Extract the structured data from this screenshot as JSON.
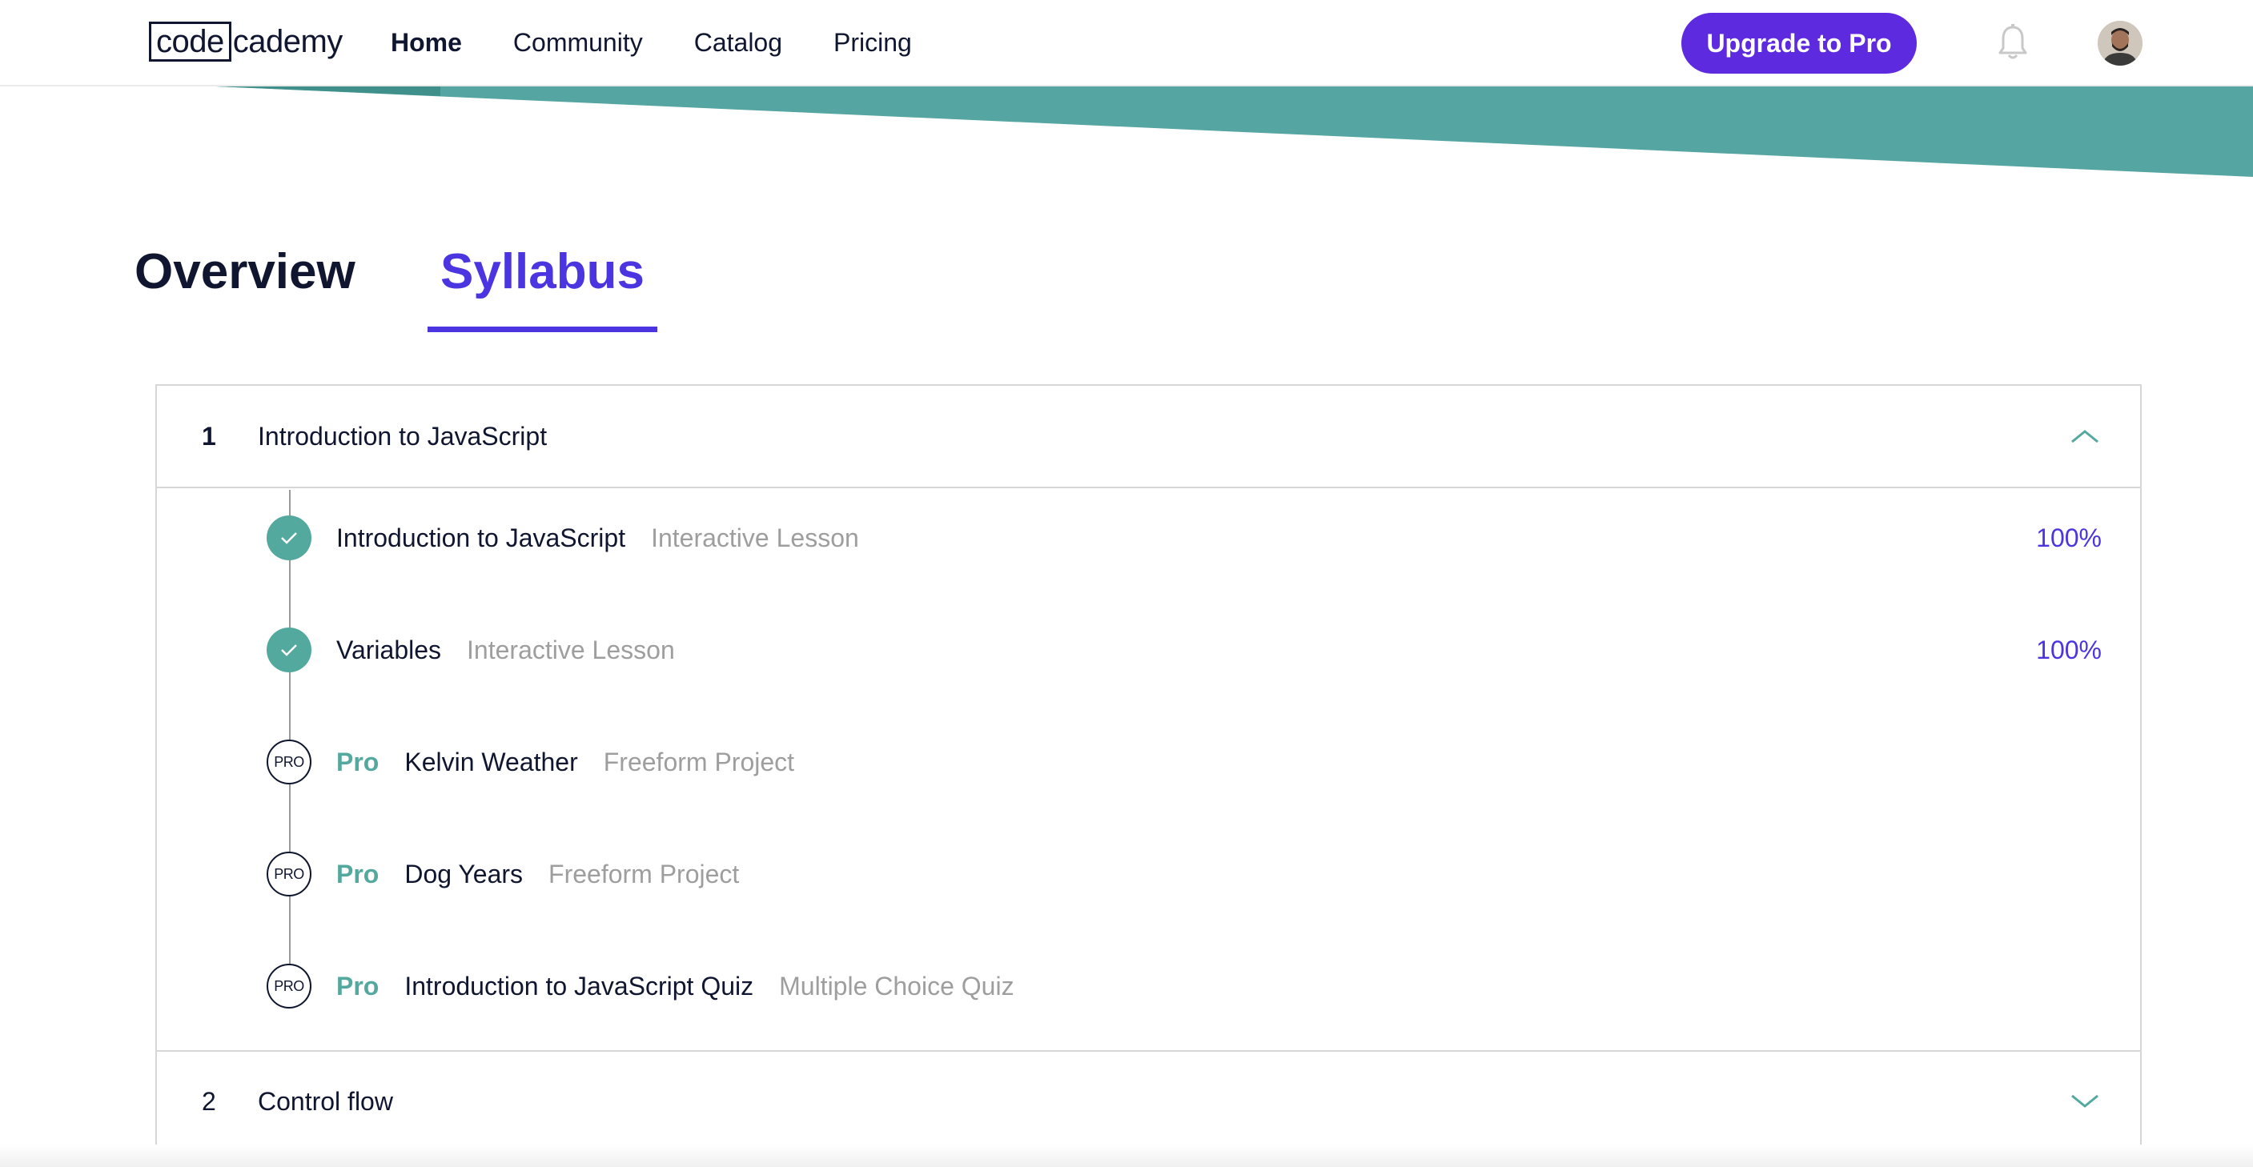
{
  "header": {
    "logo": {
      "boxed": "code",
      "rest": "cademy"
    },
    "nav": [
      {
        "label": "Home",
        "active": true
      },
      {
        "label": "Community",
        "active": false
      },
      {
        "label": "Catalog",
        "active": false
      },
      {
        "label": "Pricing",
        "active": false
      }
    ],
    "upgrade_label": "Upgrade to Pro",
    "icons": {
      "notifications": "bell-icon",
      "profile": "avatar"
    }
  },
  "tabs": [
    {
      "label": "Overview",
      "active": false
    },
    {
      "label": "Syllabus",
      "active": true
    }
  ],
  "modules": [
    {
      "number": "1",
      "title": "Introduction to JavaScript",
      "expanded": true,
      "lessons": [
        {
          "badge": "",
          "name": "Introduction to JavaScript",
          "type": "Interactive Lesson",
          "status": "complete",
          "percent": "100%"
        },
        {
          "badge": "",
          "name": "Variables",
          "type": "Interactive Lesson",
          "status": "complete",
          "percent": "100%"
        },
        {
          "badge": "Pro",
          "icon_text": "PRO",
          "name": "Kelvin Weather",
          "type": "Freeform Project",
          "status": "locked",
          "percent": ""
        },
        {
          "badge": "Pro",
          "icon_text": "PRO",
          "name": "Dog Years",
          "type": "Freeform Project",
          "status": "locked",
          "percent": ""
        },
        {
          "badge": "Pro",
          "icon_text": "PRO",
          "name": "Introduction to JavaScript Quiz",
          "type": "Multiple Choice Quiz",
          "status": "locked",
          "percent": ""
        }
      ]
    },
    {
      "number": "2",
      "title": "Control flow",
      "expanded": false,
      "lessons": []
    }
  ],
  "colors": {
    "brand_teal": "#54a99e",
    "accent_purple": "#4b35e0",
    "button_purple": "#5d2ae0",
    "text_dark": "#10162f",
    "text_muted": "#9e9e9e"
  }
}
